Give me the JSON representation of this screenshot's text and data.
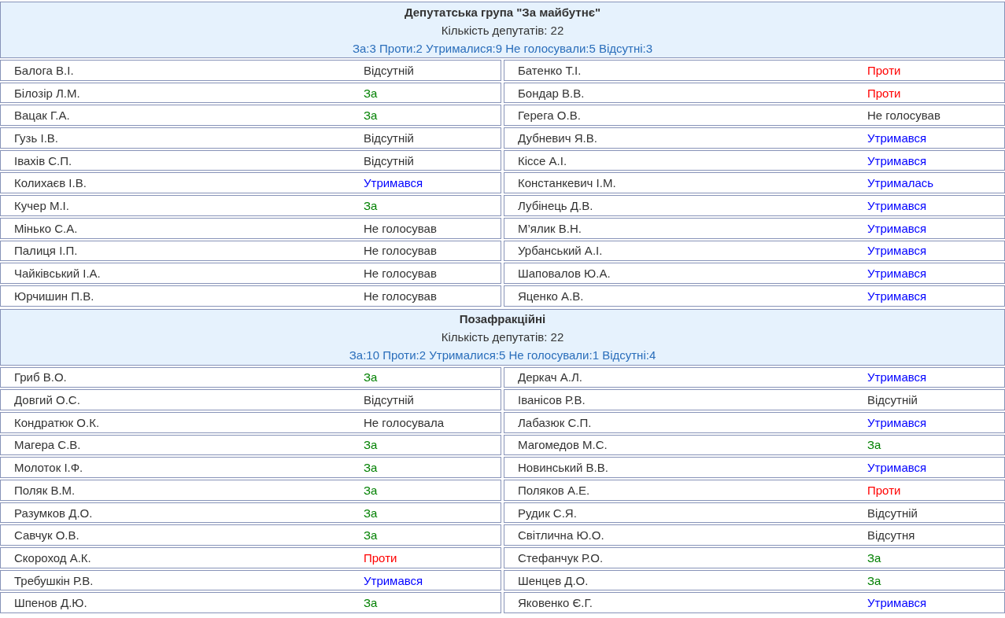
{
  "groups": [
    {
      "title": "Депутатська група \"За майбутнє\"",
      "count": "Кількість депутатів: 22",
      "summary": "За:3 Проти:2 Утрималися:9 Не голосували:5 Відсутні:3",
      "members": [
        {
          "name": "Балога В.І.",
          "vote": "Відсутній",
          "kind": "absent"
        },
        {
          "name": "Батенко Т.І.",
          "vote": "Проти",
          "kind": "against"
        },
        {
          "name": "Білозір Л.М.",
          "vote": "За",
          "kind": "for"
        },
        {
          "name": "Бондар В.В.",
          "vote": "Проти",
          "kind": "against"
        },
        {
          "name": "Вацак Г.А.",
          "vote": "За",
          "kind": "for"
        },
        {
          "name": "Герега О.В.",
          "vote": "Не голосував",
          "kind": "absent"
        },
        {
          "name": "Гузь І.В.",
          "vote": "Відсутній",
          "kind": "absent"
        },
        {
          "name": "Дубневич Я.В.",
          "vote": "Утримався",
          "kind": "abstain"
        },
        {
          "name": "Івахів С.П.",
          "vote": "Відсутній",
          "kind": "absent"
        },
        {
          "name": "Кіссе А.І.",
          "vote": "Утримався",
          "kind": "abstain"
        },
        {
          "name": "Колихаєв І.В.",
          "vote": "Утримався",
          "kind": "abstain"
        },
        {
          "name": "Констанкевич І.М.",
          "vote": "Утрималась",
          "kind": "abstain"
        },
        {
          "name": "Кучер М.І.",
          "vote": "За",
          "kind": "for"
        },
        {
          "name": "Лубінець Д.В.",
          "vote": "Утримався",
          "kind": "abstain"
        },
        {
          "name": "Мінько С.А.",
          "vote": "Не голосував",
          "kind": "absent"
        },
        {
          "name": "М’ялик В.Н.",
          "vote": "Утримався",
          "kind": "abstain"
        },
        {
          "name": "Палиця І.П.",
          "vote": "Не голосував",
          "kind": "absent"
        },
        {
          "name": "Урбанський А.І.",
          "vote": "Утримався",
          "kind": "abstain"
        },
        {
          "name": "Чайківський І.А.",
          "vote": "Не голосував",
          "kind": "absent"
        },
        {
          "name": "Шаповалов Ю.А.",
          "vote": "Утримався",
          "kind": "abstain"
        },
        {
          "name": "Юрчишин П.В.",
          "vote": "Не голосував",
          "kind": "absent"
        },
        {
          "name": "Яценко А.В.",
          "vote": "Утримався",
          "kind": "abstain"
        }
      ]
    },
    {
      "title": "Позафракційні",
      "count": "Кількість депутатів: 22",
      "summary": "За:10 Проти:2 Утрималися:5 Не голосували:1 Відсутні:4",
      "members": [
        {
          "name": "Гриб В.О.",
          "vote": "За",
          "kind": "for"
        },
        {
          "name": "Деркач А.Л.",
          "vote": "Утримався",
          "kind": "abstain"
        },
        {
          "name": "Довгий О.С.",
          "vote": "Відсутній",
          "kind": "absent"
        },
        {
          "name": "Іванісов Р.В.",
          "vote": "Відсутній",
          "kind": "absent"
        },
        {
          "name": "Кондратюк О.К.",
          "vote": "Не голосувала",
          "kind": "absent"
        },
        {
          "name": "Лабазюк С.П.",
          "vote": "Утримався",
          "kind": "abstain"
        },
        {
          "name": "Магера С.В.",
          "vote": "За",
          "kind": "for"
        },
        {
          "name": "Магомедов М.С.",
          "vote": "За",
          "kind": "for"
        },
        {
          "name": "Молоток І.Ф.",
          "vote": "За",
          "kind": "for"
        },
        {
          "name": "Новинський В.В.",
          "vote": "Утримався",
          "kind": "abstain"
        },
        {
          "name": "Поляк В.М.",
          "vote": "За",
          "kind": "for"
        },
        {
          "name": "Поляков А.Е.",
          "vote": "Проти",
          "kind": "against"
        },
        {
          "name": "Разумков Д.О.",
          "vote": "За",
          "kind": "for"
        },
        {
          "name": "Рудик С.Я.",
          "vote": "Відсутній",
          "kind": "absent"
        },
        {
          "name": "Савчук О.В.",
          "vote": "За",
          "kind": "for"
        },
        {
          "name": "Світлична Ю.О.",
          "vote": "Відсутня",
          "kind": "absent"
        },
        {
          "name": "Скороход А.К.",
          "vote": "Проти",
          "kind": "against"
        },
        {
          "name": "Стефанчук Р.О.",
          "vote": "За",
          "kind": "for"
        },
        {
          "name": "Требушкін Р.В.",
          "vote": "Утримався",
          "kind": "abstain"
        },
        {
          "name": "Шенцев Д.О.",
          "vote": "За",
          "kind": "for"
        },
        {
          "name": "Шпенов Д.Ю.",
          "vote": "За",
          "kind": "for"
        },
        {
          "name": "Яковенко Є.Г.",
          "vote": "Утримався",
          "kind": "abstain"
        }
      ]
    }
  ]
}
